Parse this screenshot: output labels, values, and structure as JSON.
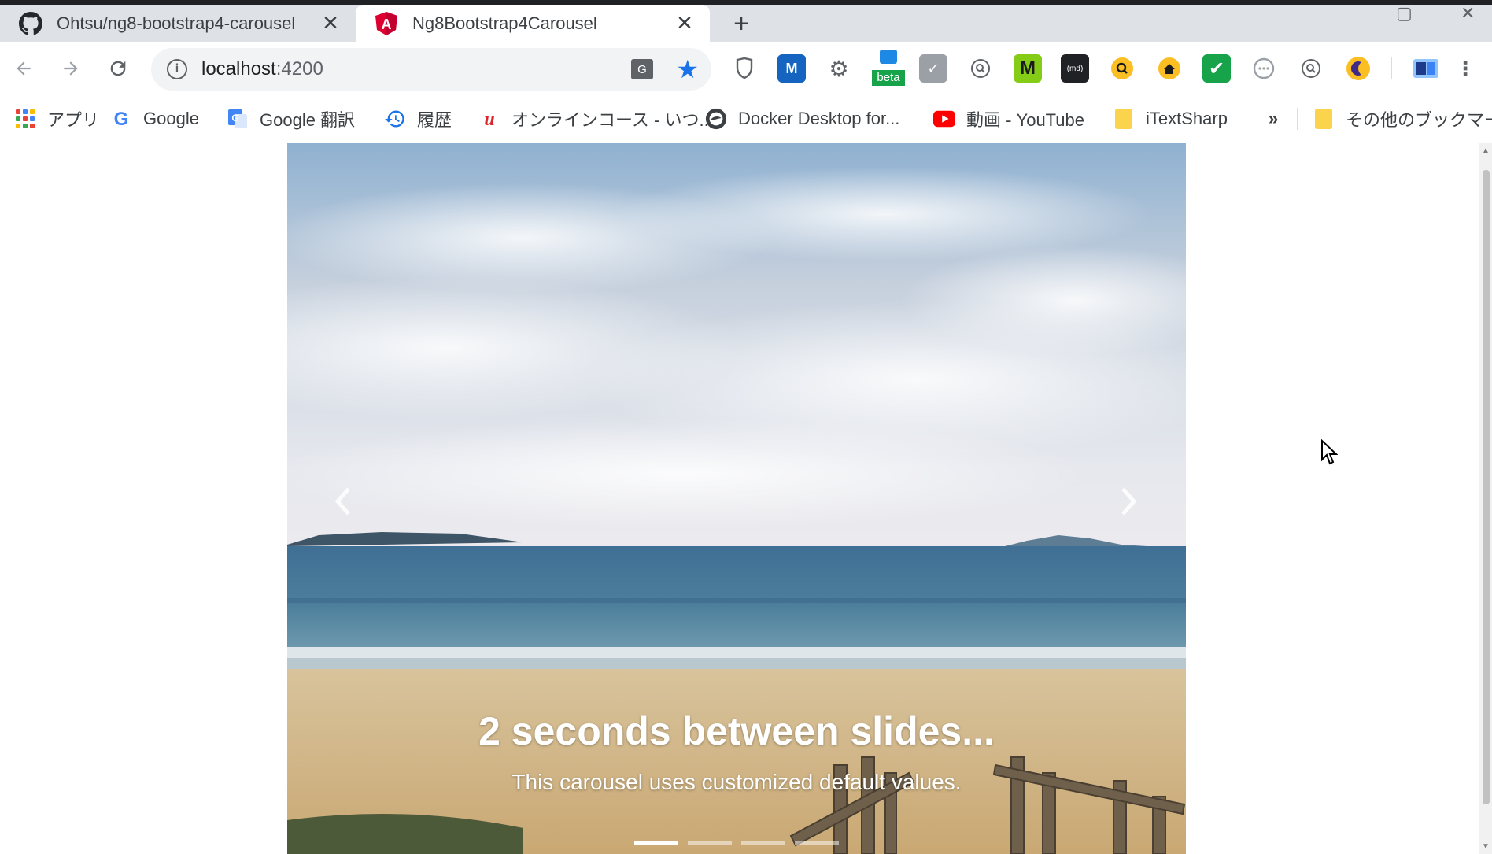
{
  "tabs": [
    {
      "title": "Ohtsu/ng8-bootstrap4-carousel",
      "icon": "github-icon"
    },
    {
      "title": "Ng8Bootstrap4Carousel",
      "icon": "angular-icon",
      "active": true
    }
  ],
  "toolbar": {
    "url_host": "localhost",
    "url_port": ":4200",
    "extensions": [
      "shield-extension-icon",
      "m-extension-icon",
      "film-extension-icon",
      "beta-extension-icon",
      "chart-extension-icon",
      "search-extension-icon",
      "m-green-extension-icon",
      "md-extension-icon",
      "zoom-extension-icon",
      "home-extension-icon",
      "check-extension-icon",
      "comment-extension-icon",
      "zoom2-extension-icon",
      "moon-extension-icon",
      "translate-extension-icon"
    ],
    "beta_label": "beta",
    "md_label": "md"
  },
  "bookmarks": {
    "apps": "アプリ",
    "google": "Google",
    "google_translate": "Google 翻訳",
    "history": "履歴",
    "online_course": "オンラインコース - いつ...",
    "docker": "Docker Desktop for...",
    "youtube": "動画 - YouTube",
    "itextsharp": "iTextSharp",
    "overflow": "»",
    "other": "その他のブックマーク"
  },
  "carousel": {
    "caption_title": "2 seconds between slides...",
    "caption_text": "This carousel uses customized default values.",
    "slide_count": 4,
    "active_slide": 1
  }
}
